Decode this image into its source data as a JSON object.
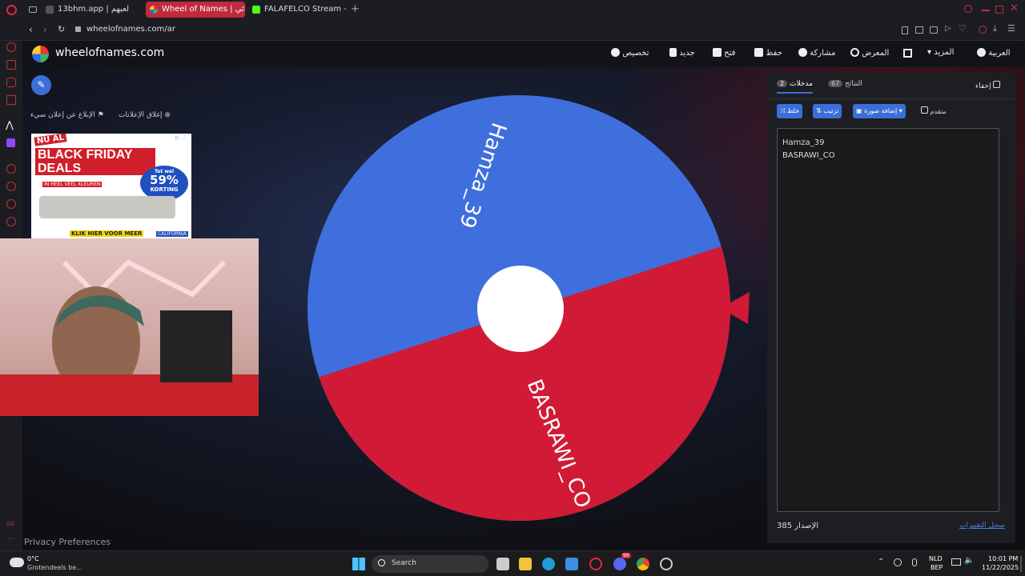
{
  "tabs": [
    {
      "label": "13bhm.app | لعبهم",
      "active": false
    },
    {
      "label": "Wheel of Names | عشوائي",
      "active": true
    },
    {
      "label": "FALAFELCO Stream - Wat",
      "active": false
    }
  ],
  "address": {
    "url": "wheelofnames.com/ar"
  },
  "site": {
    "logo_text": "wheelofnames.com"
  },
  "nav": {
    "language": "العربية",
    "more": "المزيد",
    "gallery": "المعرض",
    "share": "مشاركة",
    "save": "حفظ",
    "open": "فتح",
    "new": "جديد",
    "customize": "تخصيص"
  },
  "ads": {
    "report": "الإبلاغ عن إعلان سيء",
    "close": "إغلاق الإعلانات",
    "ad_line1": "NU AL",
    "ad_line2": "BLACK FRIDAY DEALS",
    "ad_sub": "IN HEEL VEEL KLEUREN",
    "ad_badge_top": "Tot wel",
    "ad_badge_pct": "59%",
    "ad_badge_bottom": "KORTING",
    "ad_cta": "KLIK HIER VOOR MEER",
    "ad_brand": "CALIFORNIA"
  },
  "wheel": {
    "segments": [
      {
        "label": "Hamza_39",
        "color": "#3f6fdc"
      },
      {
        "label": "BASRAWI_CO",
        "color": "#d11a36"
      }
    ]
  },
  "panel": {
    "tab_entries": "مدخلات",
    "entries_count": "2",
    "tab_results": "النتائج",
    "results_count": "67",
    "hide": "إخفاء",
    "shuffle": "خلط",
    "sort": "ترتيب",
    "add_image": "إضافة صورة",
    "advanced": "متقدم",
    "entries": [
      "Hamza_39",
      "BASRAWI_CO"
    ],
    "version": "الإصدار 385",
    "changelog": "سجل التغييرات"
  },
  "footer": {
    "privacy": "Privacy Preferences",
    "gx": "GX"
  },
  "taskbar": {
    "temp": "0°C",
    "weather": "Grotendeels be...",
    "search": "Search",
    "lang": "NLD",
    "region": "BEP",
    "time": "10:01 PM",
    "date": "11/22/2025",
    "badge": "99"
  }
}
